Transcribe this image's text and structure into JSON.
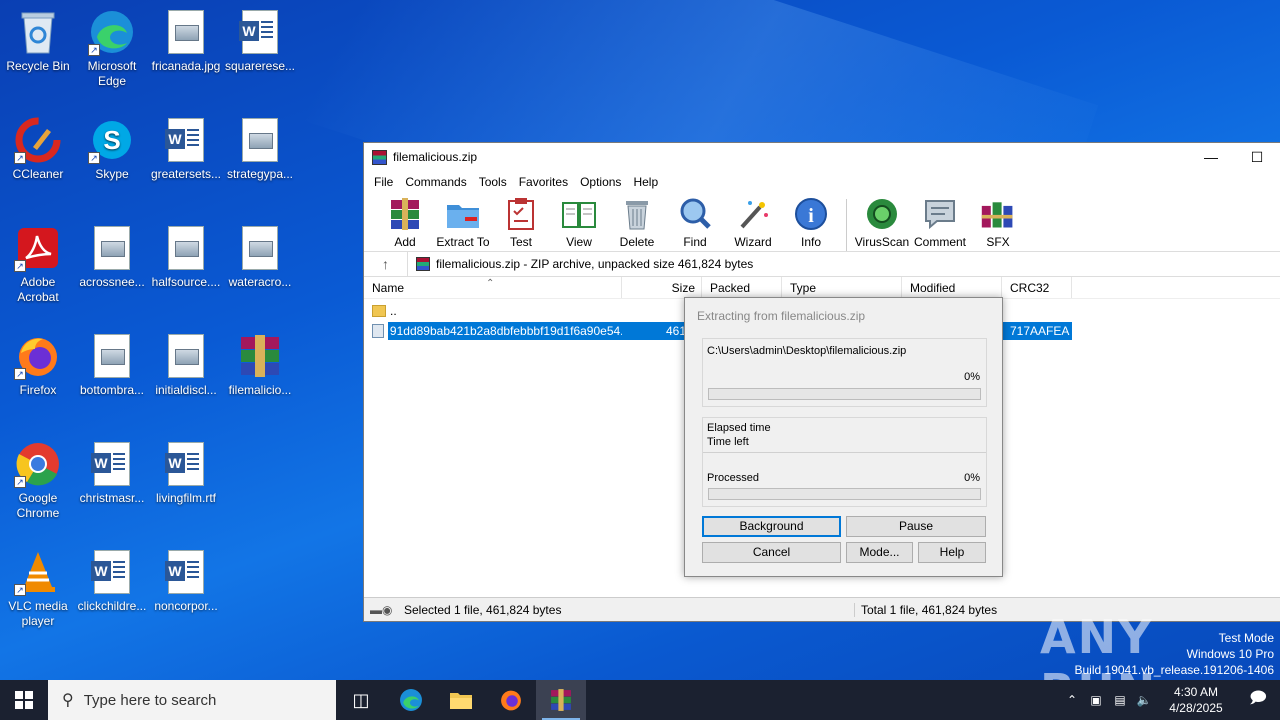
{
  "desktop": {
    "icons": [
      {
        "label": "Recycle Bin",
        "icon": "recycle-bin-icon"
      },
      {
        "label": "Microsoft Edge",
        "icon": "edge-icon"
      },
      {
        "label": "fricanada.jpg",
        "icon": "image-file-icon"
      },
      {
        "label": "squarerese...",
        "icon": "word-doc-icon"
      },
      {
        "label": "CCleaner",
        "icon": "ccleaner-icon"
      },
      {
        "label": "Skype",
        "icon": "skype-icon"
      },
      {
        "label": "greatersets...",
        "icon": "word-doc-icon"
      },
      {
        "label": "strategypa...",
        "icon": "image-file-icon"
      },
      {
        "label": "Adobe Acrobat",
        "icon": "acrobat-icon"
      },
      {
        "label": "acrossnee...",
        "icon": "image-file-icon"
      },
      {
        "label": "halfsource....",
        "icon": "image-file-icon"
      },
      {
        "label": "wateracro...",
        "icon": "image-file-icon"
      },
      {
        "label": "Firefox",
        "icon": "firefox-icon"
      },
      {
        "label": "bottombra...",
        "icon": "image-file-icon"
      },
      {
        "label": "initialdiscl...",
        "icon": "image-file-icon"
      },
      {
        "label": "filemalicio...",
        "icon": "winrar-icon"
      },
      {
        "label": "Google Chrome",
        "icon": "chrome-icon"
      },
      {
        "label": "christmasr...",
        "icon": "word-doc-icon"
      },
      {
        "label": "livingfilm.rtf",
        "icon": "word-doc-icon"
      },
      {
        "label": "VLC media player",
        "icon": "vlc-icon"
      },
      {
        "label": "clickchildre...",
        "icon": "word-doc-icon"
      },
      {
        "label": "noncorpor...",
        "icon": "word-doc-icon"
      }
    ]
  },
  "window": {
    "title": "filemalicious.zip",
    "menu": [
      "File",
      "Commands",
      "Tools",
      "Favorites",
      "Options",
      "Help"
    ],
    "toolbar": [
      "Add",
      "Extract To",
      "Test",
      "View",
      "Delete",
      "Find",
      "Wizard",
      "Info",
      "VirusScan",
      "Comment",
      "SFX"
    ],
    "address": "filemalicious.zip - ZIP archive, unpacked size 461,824 bytes",
    "columns": [
      "Name",
      "Size",
      "Packed",
      "Type",
      "Modified",
      "CRC32"
    ],
    "rows": [
      {
        "name": "..",
        "size": "",
        "crc": ""
      },
      {
        "name": "91dd89bab421b2a8dbfebbbf19d1f6a90e54...",
        "size": "461,8",
        "crc": "717AAFEA"
      }
    ],
    "status_left": "Selected 1 file, 461,824 bytes",
    "status_right": "Total 1 file, 461,824 bytes"
  },
  "dialog": {
    "title": "Extracting from filemalicious.zip",
    "path": "C:\\Users\\admin\\Desktop\\filemalicious.zip",
    "file_percent": "0%",
    "file_progress": 0,
    "elapsed_label": "Elapsed time",
    "left_label": "Time left",
    "processed_label": "Processed",
    "processed_percent": "0%",
    "processed_progress": 0,
    "buttons": {
      "background": "Background",
      "pause": "Pause",
      "cancel": "Cancel",
      "mode": "Mode...",
      "help": "Help"
    }
  },
  "taskbar": {
    "search_placeholder": "Type here to search",
    "time": "4:30 AM",
    "date": "4/28/2025"
  },
  "watermark": {
    "line1": "Test Mode",
    "line2": "Windows 10 Pro",
    "line3": "Build 19041.vb_release.191206-1406",
    "brand": "ANY RUN"
  }
}
